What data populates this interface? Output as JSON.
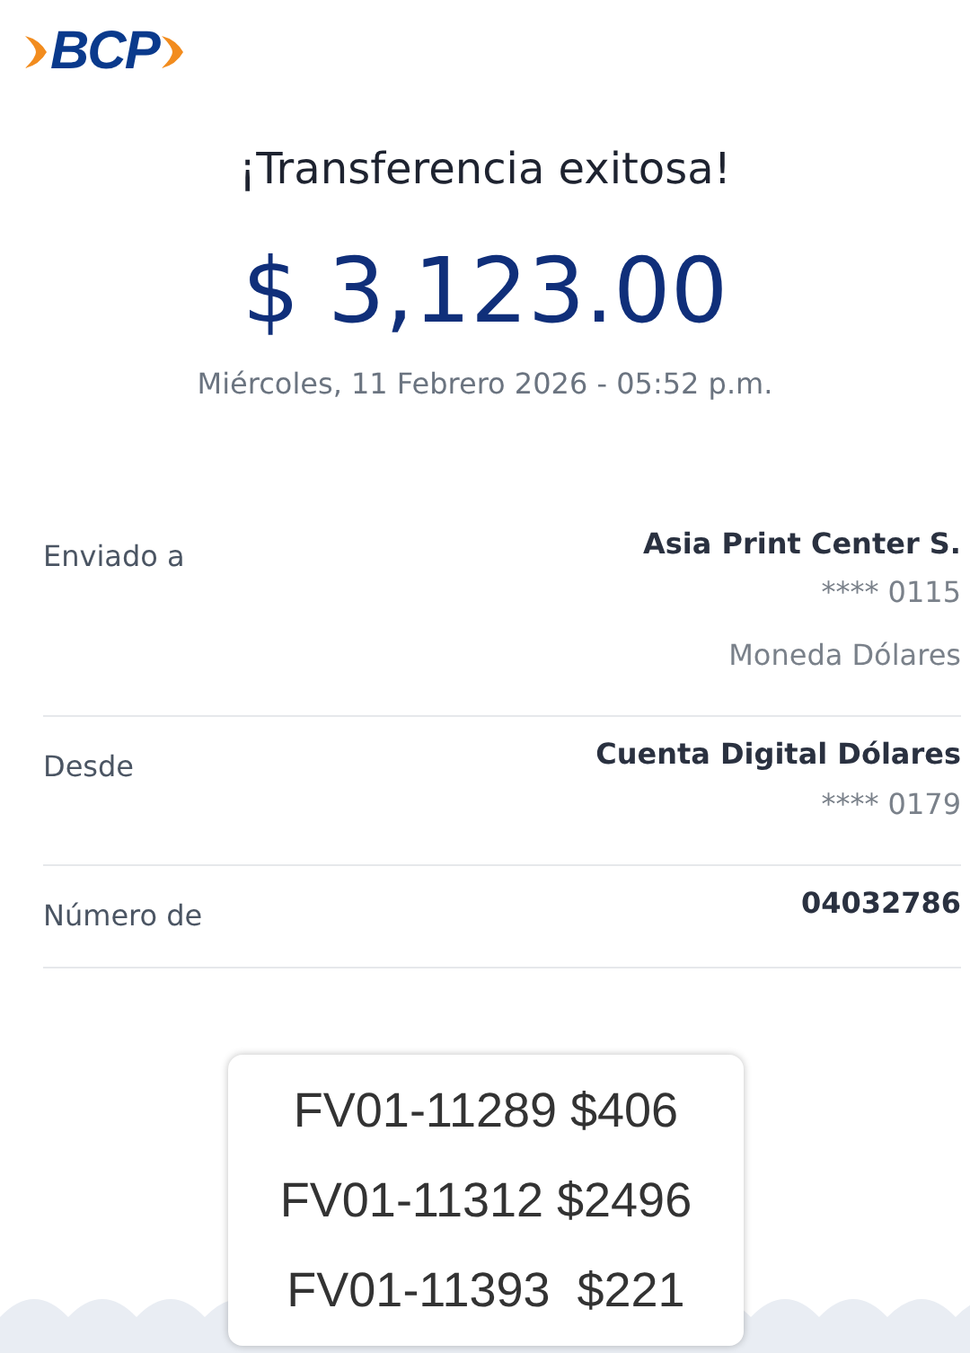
{
  "logo": {
    "text": "BCP"
  },
  "title": "¡Transferencia exitosa!",
  "amount": "$ 3,123.00",
  "date": "Miércoles, 11 Febrero 2026 - 05:52 p.m.",
  "rows": [
    {
      "label": "Enviado a",
      "values": [
        {
          "text": "Asia Print Center S.",
          "kind": "primary"
        },
        {
          "text": "**** 0115",
          "kind": "secondary"
        },
        {
          "text": "Moneda Dólares",
          "kind": "secondary"
        }
      ]
    },
    {
      "label": "Desde",
      "values": [
        {
          "text": "Cuenta Digital Dólares",
          "kind": "primary"
        },
        {
          "text": "**** 0179",
          "kind": "secondary"
        }
      ]
    },
    {
      "label": "Número de",
      "values": [
        {
          "text": "04032786",
          "kind": "primary"
        }
      ]
    }
  ],
  "note": {
    "lines": [
      "FV01-11289 $406",
      "FV01-11312 $2496",
      "FV01-11393  $221"
    ]
  }
}
